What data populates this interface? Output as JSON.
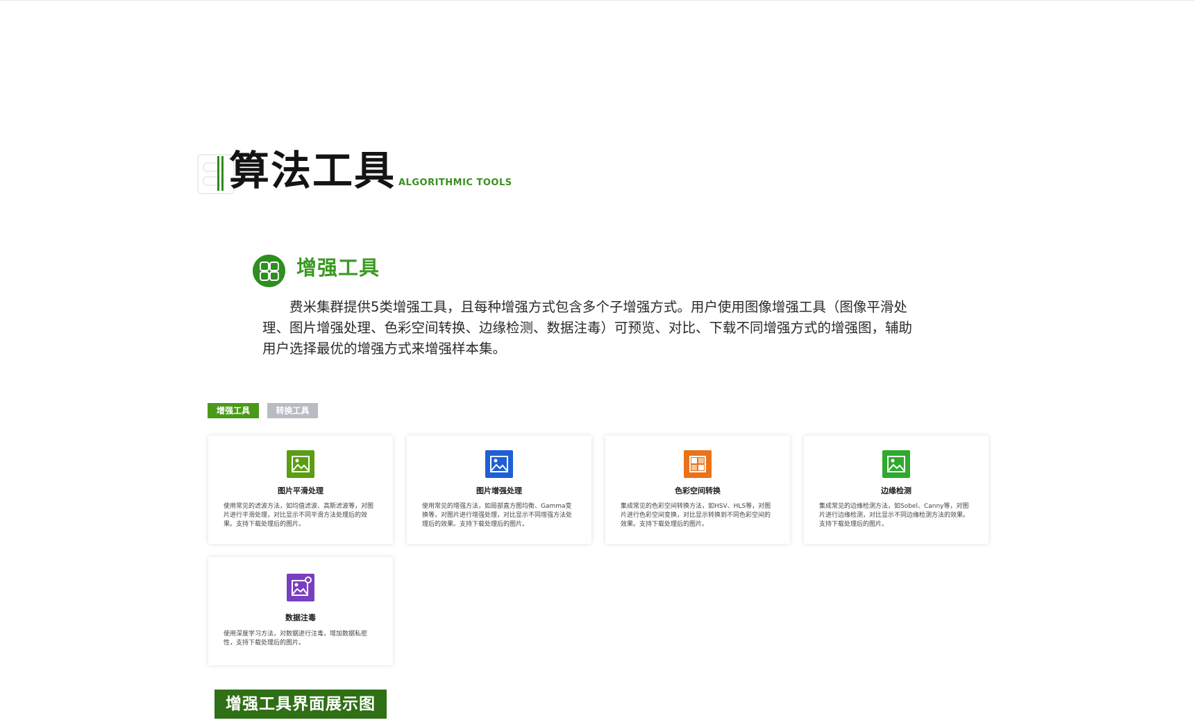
{
  "header": {
    "title": "算法工具",
    "subtitle": "ALGORITHMIC TOOLS"
  },
  "section": {
    "title": "增强工具",
    "icon": "grid-icon",
    "description": "费米集群提供5类增强工具，且每种增强方式包含多个子增强方式。用户使用图像增强工具（图像平滑处理、图片增强处理、色彩空间转换、边缘检测、数据注毒）可预览、对比、下载不同增强方式的增强图，辅助用户选择最优的增强方式来增强样本集。"
  },
  "tabs": [
    {
      "label": "增强工具",
      "active": true
    },
    {
      "label": "转换工具",
      "active": false
    }
  ],
  "cards": [
    {
      "title": "图片平滑处理",
      "description": "使用常见的滤波方法，如均值滤波、高斯滤波等，对图片进行平滑处理，对比显示不同平滑方法处理后的效果。支持下载处理后的图片。",
      "icon": "image-icon",
      "color": "#5a9e12"
    },
    {
      "title": "图片增强处理",
      "description": "使用常见的增强方法，如局部直方图均衡、Gamma变换等，对图片进行增强处理，对比显示不同增强方法处理后的效果。支持下载处理后的图片。",
      "icon": "image-icon",
      "color": "#1e5fd6"
    },
    {
      "title": "色彩空间转换",
      "description": "集成常见的色彩空间转换方法，如HSV、HLS等，对图片进行色彩空间变换，对比显示转换到不同色彩空间的效果。支持下载处理后的图片。",
      "icon": "color-blocks-icon",
      "color": "#e8731a"
    },
    {
      "title": "边缘检测",
      "description": "集成常见的边缘检测方法，如Sobel、Canny等，对图片进行边缘检测，对比显示不同边缘检测方法的效果。支持下载处理后的图片。",
      "icon": "image-icon",
      "color": "#2eaa2e"
    },
    {
      "title": "数据注毒",
      "description": "使用深度学习方法，对数据进行注毒，增加数据私密性，支持下载处理后的图片。",
      "icon": "image-edit-icon",
      "color": "#7a3fc0"
    }
  ],
  "banner": {
    "label": "增强工具界面展示图"
  }
}
